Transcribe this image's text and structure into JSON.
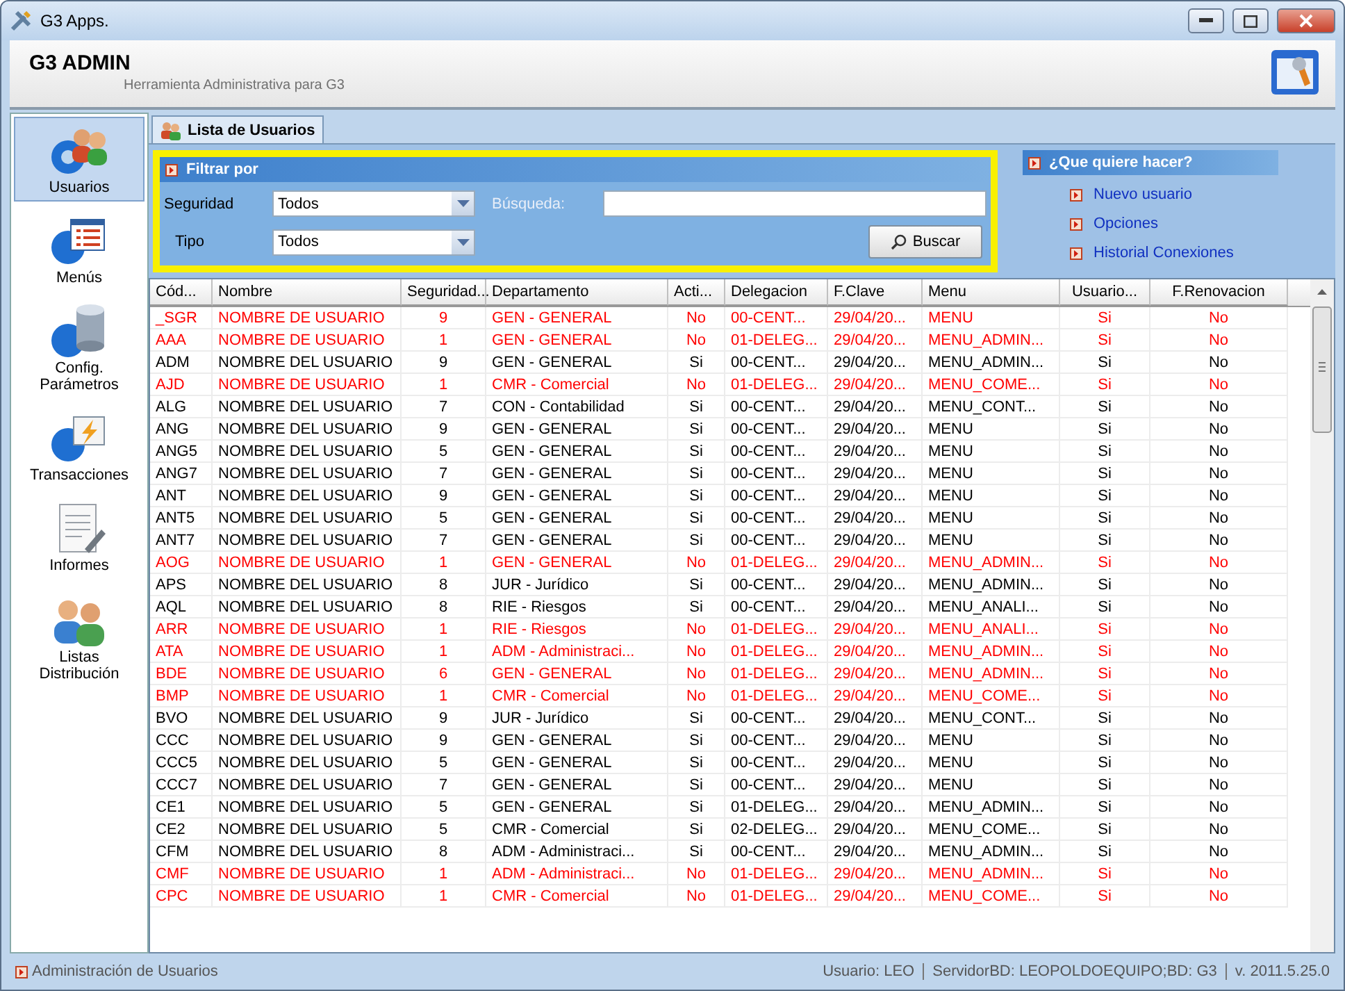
{
  "window": {
    "title": "G3 Apps."
  },
  "header": {
    "title": "G3 ADMIN",
    "subtitle": "Herramienta Administrativa para G3"
  },
  "sidebar": {
    "items": [
      {
        "label": "Usuarios",
        "selected": true
      },
      {
        "label": "Menús",
        "selected": false
      },
      {
        "label": "Config.\nParámetros",
        "selected": false
      },
      {
        "label": "Transacciones",
        "selected": false
      },
      {
        "label": "Informes",
        "selected": false
      },
      {
        "label": "Listas\nDistribución",
        "selected": false
      }
    ]
  },
  "tabs": [
    {
      "label": "Lista de Usuarios",
      "selected": true
    }
  ],
  "filter": {
    "title": "Filtrar por",
    "security_label": "Seguridad",
    "security_value": "Todos",
    "type_label": "Tipo",
    "type_value": "Todos",
    "search_label": "Búsqueda:",
    "search_button": "Buscar"
  },
  "actions": {
    "title": "¿Que quiere hacer?",
    "links": [
      "Nuevo usuario",
      "Opciones",
      "Historial Conexiones"
    ]
  },
  "table": {
    "columns": [
      "Cód...",
      "Nombre",
      "Seguridad...",
      "Departamento",
      "Acti...",
      "Delegacion",
      "F.Clave",
      "Menu",
      "Usuario...",
      "F.Renovacion"
    ],
    "rows": [
      {
        "flagged": true,
        "cells": [
          "_SGR",
          "NOMBRE DE USUARIO",
          "9",
          "GEN - GENERAL",
          "No",
          "00-CENT...",
          "29/04/20...",
          "MENU",
          "Si",
          "No"
        ]
      },
      {
        "flagged": true,
        "cells": [
          "AAA",
          "NOMBRE DE USUARIO",
          "1",
          "GEN - GENERAL",
          "No",
          "01-DELEG...",
          "29/04/20...",
          "MENU_ADMIN...",
          "Si",
          "No"
        ]
      },
      {
        "flagged": false,
        "cells": [
          "ADM",
          "NOMBRE DEL USUARIO",
          "9",
          "GEN - GENERAL",
          "Si",
          "00-CENT...",
          "29/04/20...",
          "MENU_ADMIN...",
          "Si",
          "No"
        ]
      },
      {
        "flagged": true,
        "cells": [
          "AJD",
          "NOMBRE DE USUARIO",
          "1",
          "CMR - Comercial",
          "No",
          "01-DELEG...",
          "29/04/20...",
          "MENU_COME...",
          "Si",
          "No"
        ]
      },
      {
        "flagged": false,
        "cells": [
          "ALG",
          "NOMBRE DEL USUARIO",
          "7",
          "CON - Contabilidad",
          "Si",
          "00-CENT...",
          "29/04/20...",
          "MENU_CONT...",
          "Si",
          "No"
        ]
      },
      {
        "flagged": false,
        "cells": [
          "ANG",
          "NOMBRE DEL USUARIO",
          "9",
          "GEN - GENERAL",
          "Si",
          "00-CENT...",
          "29/04/20...",
          "MENU",
          "Si",
          "No"
        ]
      },
      {
        "flagged": false,
        "cells": [
          "ANG5",
          "NOMBRE DEL USUARIO",
          "5",
          "GEN - GENERAL",
          "Si",
          "00-CENT...",
          "29/04/20...",
          "MENU",
          "Si",
          "No"
        ]
      },
      {
        "flagged": false,
        "cells": [
          "ANG7",
          "NOMBRE DEL USUARIO",
          "7",
          "GEN - GENERAL",
          "Si",
          "00-CENT...",
          "29/04/20...",
          "MENU",
          "Si",
          "No"
        ]
      },
      {
        "flagged": false,
        "cells": [
          "ANT",
          "NOMBRE DEL USUARIO",
          "9",
          "GEN - GENERAL",
          "Si",
          "00-CENT...",
          "29/04/20...",
          "MENU",
          "Si",
          "No"
        ]
      },
      {
        "flagged": false,
        "cells": [
          "ANT5",
          "NOMBRE DEL USUARIO",
          "5",
          "GEN - GENERAL",
          "Si",
          "00-CENT...",
          "29/04/20...",
          "MENU",
          "Si",
          "No"
        ]
      },
      {
        "flagged": false,
        "cells": [
          "ANT7",
          "NOMBRE DEL USUARIO",
          "7",
          "GEN - GENERAL",
          "Si",
          "00-CENT...",
          "29/04/20...",
          "MENU",
          "Si",
          "No"
        ]
      },
      {
        "flagged": true,
        "cells": [
          "AOG",
          "NOMBRE DE USUARIO",
          "1",
          "GEN - GENERAL",
          "No",
          "01-DELEG...",
          "29/04/20...",
          "MENU_ADMIN...",
          "Si",
          "No"
        ]
      },
      {
        "flagged": false,
        "cells": [
          "APS",
          "NOMBRE DEL USUARIO",
          "8",
          "JUR - Jurídico",
          "Si",
          "00-CENT...",
          "29/04/20...",
          "MENU_ADMIN...",
          "Si",
          "No"
        ]
      },
      {
        "flagged": false,
        "cells": [
          "AQL",
          "NOMBRE DEL USUARIO",
          "8",
          "RIE - Riesgos",
          "Si",
          "00-CENT...",
          "29/04/20...",
          "MENU_ANALI...",
          "Si",
          "No"
        ]
      },
      {
        "flagged": true,
        "cells": [
          "ARR",
          "NOMBRE DE USUARIO",
          "1",
          "RIE - Riesgos",
          "No",
          "01-DELEG...",
          "29/04/20...",
          "MENU_ANALI...",
          "Si",
          "No"
        ]
      },
      {
        "flagged": true,
        "cells": [
          "ATA",
          "NOMBRE DE USUARIO",
          "1",
          "ADM - Administraci...",
          "No",
          "01-DELEG...",
          "29/04/20...",
          "MENU_ADMIN...",
          "Si",
          "No"
        ]
      },
      {
        "flagged": true,
        "cells": [
          "BDE",
          "NOMBRE DE USUARIO",
          "6",
          "GEN - GENERAL",
          "No",
          "01-DELEG...",
          "29/04/20...",
          "MENU_ADMIN...",
          "Si",
          "No"
        ]
      },
      {
        "flagged": true,
        "cells": [
          "BMP",
          "NOMBRE DE USUARIO",
          "1",
          "CMR - Comercial",
          "No",
          "01-DELEG...",
          "29/04/20...",
          "MENU_COME...",
          "Si",
          "No"
        ]
      },
      {
        "flagged": false,
        "cells": [
          "BVO",
          "NOMBRE DEL USUARIO",
          "9",
          "JUR - Jurídico",
          "Si",
          "00-CENT...",
          "29/04/20...",
          "MENU_CONT...",
          "Si",
          "No"
        ]
      },
      {
        "flagged": false,
        "cells": [
          "CCC",
          "NOMBRE DEL USUARIO",
          "9",
          "GEN - GENERAL",
          "Si",
          "00-CENT...",
          "29/04/20...",
          "MENU",
          "Si",
          "No"
        ]
      },
      {
        "flagged": false,
        "cells": [
          "CCC5",
          "NOMBRE DEL USUARIO",
          "5",
          "GEN - GENERAL",
          "Si",
          "00-CENT...",
          "29/04/20...",
          "MENU",
          "Si",
          "No"
        ]
      },
      {
        "flagged": false,
        "cells": [
          "CCC7",
          "NOMBRE DEL USUARIO",
          "7",
          "GEN - GENERAL",
          "Si",
          "00-CENT...",
          "29/04/20...",
          "MENU",
          "Si",
          "No"
        ]
      },
      {
        "flagged": false,
        "cells": [
          "CE1",
          "NOMBRE DEL USUARIO",
          "5",
          "GEN - GENERAL",
          "Si",
          "01-DELEG...",
          "29/04/20...",
          "MENU_ADMIN...",
          "Si",
          "No"
        ]
      },
      {
        "flagged": false,
        "cells": [
          "CE2",
          "NOMBRE DEL USUARIO",
          "5",
          "CMR - Comercial",
          "Si",
          "02-DELEG...",
          "29/04/20...",
          "MENU_COME...",
          "Si",
          "No"
        ]
      },
      {
        "flagged": false,
        "cells": [
          "CFM",
          "NOMBRE DEL USUARIO",
          "8",
          "ADM - Administraci...",
          "Si",
          "00-CENT...",
          "29/04/20...",
          "MENU_ADMIN...",
          "Si",
          "No"
        ]
      },
      {
        "flagged": true,
        "cells": [
          "CMF",
          "NOMBRE DE USUARIO",
          "1",
          "ADM - Administraci...",
          "No",
          "01-DELEG...",
          "29/04/20...",
          "MENU_ADMIN...",
          "Si",
          "No"
        ]
      },
      {
        "flagged": true,
        "cells": [
          "CPC",
          "NOMBRE DE USUARIO",
          "1",
          "CMR - Comercial",
          "No",
          "01-DELEG...",
          "29/04/20...",
          "MENU_COME...",
          "Si",
          "No"
        ]
      }
    ]
  },
  "status_bar": {
    "left": "Administración de Usuarios",
    "user": "Usuario: LEO",
    "server": "ServidorBD: LEOPOLDOEQUIPO;BD: G3",
    "version": "v. 2011.5.25.0"
  }
}
